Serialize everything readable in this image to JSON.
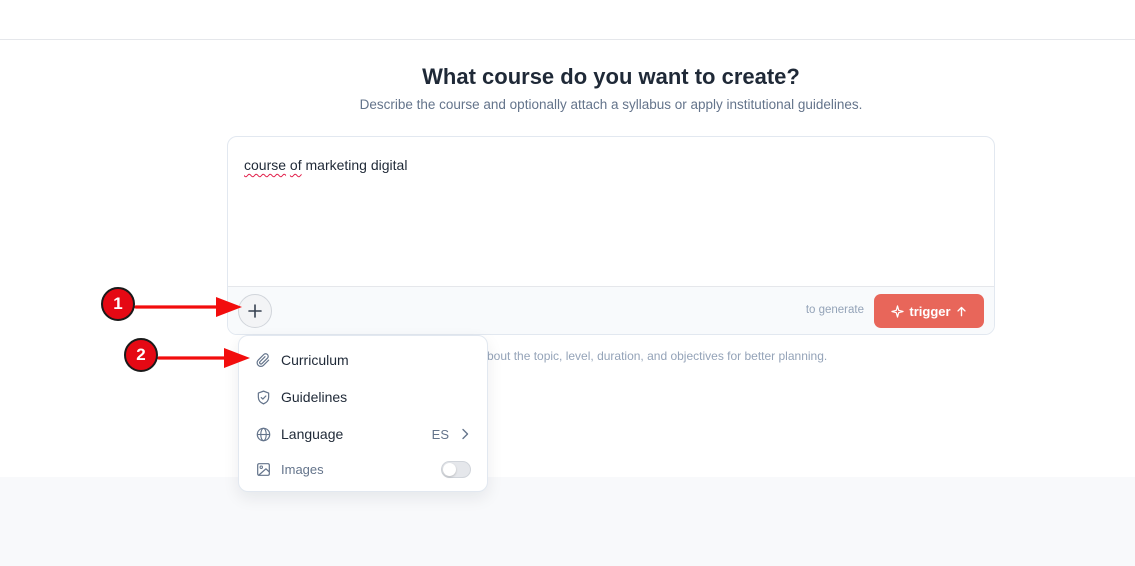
{
  "header": {
    "title": "What course do you want to create?",
    "subtitle": "Describe the course and optionally attach a syllabus or apply institutional guidelines."
  },
  "composer": {
    "text_parts": [
      "course",
      "of",
      "marketing digital"
    ],
    "hint": "to generate",
    "trigger_label": "trigger",
    "below_hint": "bout the topic, level, duration, and objectives for better planning."
  },
  "menu": {
    "items": [
      {
        "label": "Curriculum",
        "icon": "paperclip-icon"
      },
      {
        "label": "Guidelines",
        "icon": "shield-check-icon"
      },
      {
        "label": "Language",
        "icon": "globe-icon",
        "value": "ES"
      },
      {
        "label": "Images",
        "icon": "image-icon",
        "toggle": false
      }
    ]
  },
  "annotations": [
    {
      "number": "1",
      "target": "plus-button"
    },
    {
      "number": "2",
      "target": "menu-item-curriculum"
    }
  ],
  "colors": {
    "accent": "#e8665a",
    "annotation_red": "#e50914"
  }
}
